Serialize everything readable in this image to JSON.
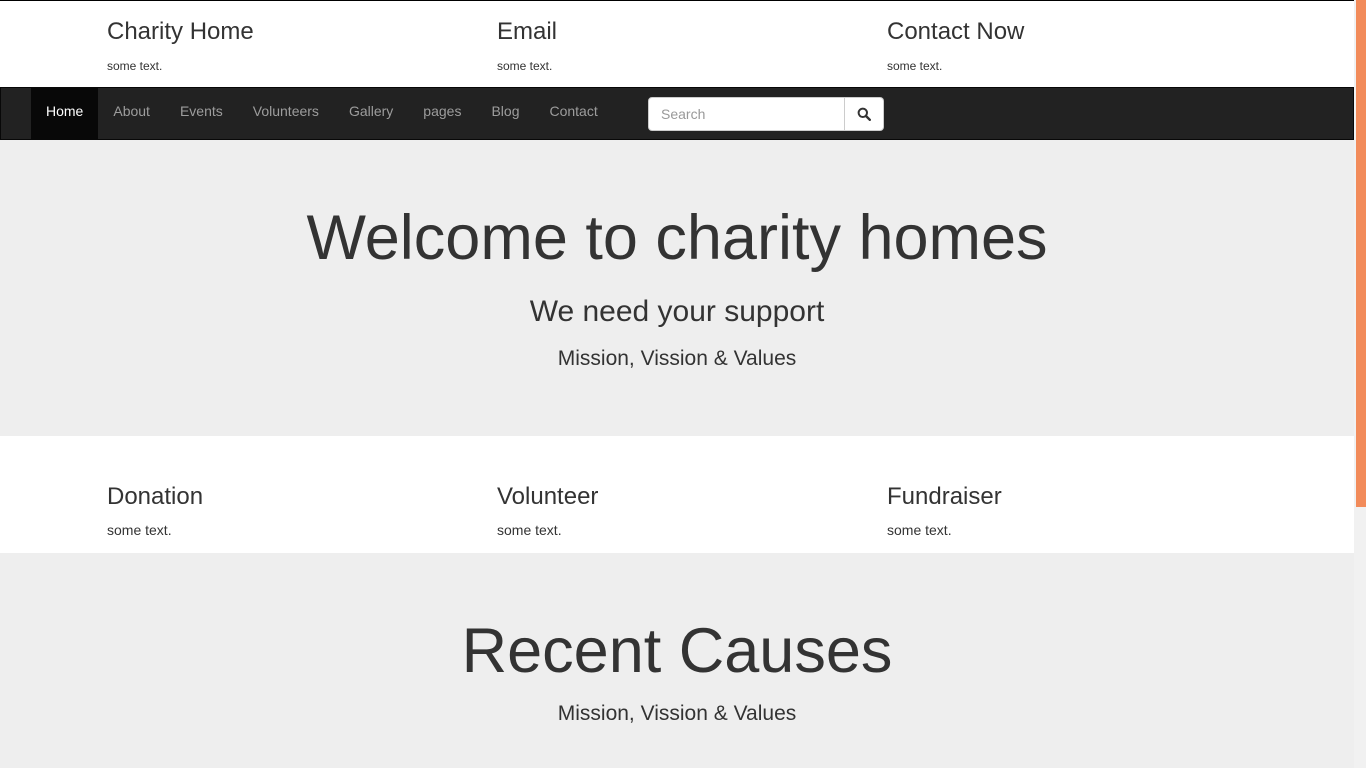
{
  "top_info": [
    {
      "title": "Charity Home",
      "text": "some text."
    },
    {
      "title": "Email",
      "text": "some text."
    },
    {
      "title": "Contact Now",
      "text": "some text."
    }
  ],
  "nav": {
    "items": [
      "Home",
      "About",
      "Events",
      "Volunteers",
      "Gallery",
      "pages",
      "Blog",
      "Contact"
    ],
    "active": "Home",
    "search_placeholder": "Search",
    "search_icon": "search-icon"
  },
  "hero": {
    "title": "Welcome to charity homes",
    "subtitle": "We need your support",
    "tagline": "Mission, Vission & Values"
  },
  "features": [
    {
      "title": "Donation",
      "text": "some text."
    },
    {
      "title": "Volunteer",
      "text": "some text."
    },
    {
      "title": "Fundraiser",
      "text": "some text."
    }
  ],
  "causes": {
    "title": "Recent Causes",
    "tagline": "Mission, Vission & Values"
  },
  "colors": {
    "navbar_bg": "#222222",
    "nav_active_bg": "#080808",
    "section_bg": "#eeeeee",
    "scrollbar_thumb": "#f28b5a"
  }
}
